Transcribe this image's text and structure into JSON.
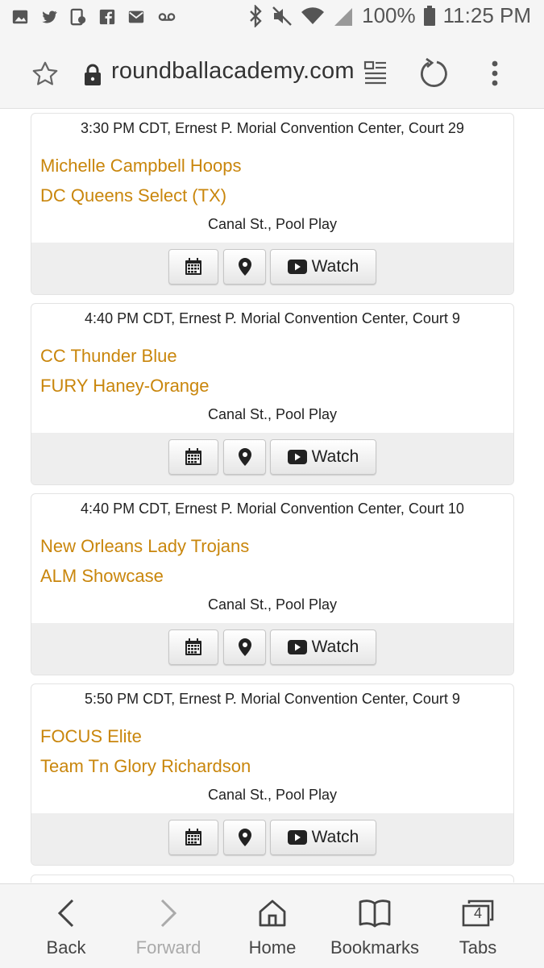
{
  "status_bar": {
    "battery": "100%",
    "time": "11:25 PM",
    "left_icons": [
      "gallery-icon",
      "twitter-icon",
      "screen-sync-icon",
      "facebook-icon",
      "email-icon",
      "voicemail-icon"
    ],
    "right_icons": [
      "bluetooth-icon",
      "mute-icon",
      "wifi-icon",
      "signal-icon",
      "battery-icon"
    ]
  },
  "browser": {
    "url": "roundballacademy.com"
  },
  "games": [
    {
      "time": "3:30 PM CDT, Ernest P. Morial Convention Center, Court 29",
      "team1": "Michelle Campbell Hoops",
      "team2": "DC Queens Select (TX)",
      "venue": "Canal St., Pool Play",
      "watch_label": "Watch"
    },
    {
      "time": "4:40 PM CDT, Ernest P. Morial Convention Center, Court 9",
      "team1": "CC Thunder Blue",
      "team2": "FURY Haney-Orange",
      "venue": "Canal St., Pool Play",
      "watch_label": "Watch"
    },
    {
      "time": "4:40 PM CDT, Ernest P. Morial Convention Center, Court 10",
      "team1": "New Orleans Lady Trojans",
      "team2": "ALM Showcase",
      "venue": "Canal St., Pool Play",
      "watch_label": "Watch"
    },
    {
      "time": "5:50 PM CDT, Ernest P. Morial Convention Center, Court 9",
      "team1": "FOCUS Elite",
      "team2": "Team Tn Glory Richardson",
      "venue": "Canal St., Pool Play",
      "watch_label": "Watch"
    }
  ],
  "bottom_nav": {
    "back": "Back",
    "forward": "Forward",
    "home": "Home",
    "bookmarks": "Bookmarks",
    "tabs": "Tabs",
    "tab_count": "4"
  },
  "colors": {
    "team_link": "#c9860c",
    "actions_bg": "#eeeeee"
  }
}
